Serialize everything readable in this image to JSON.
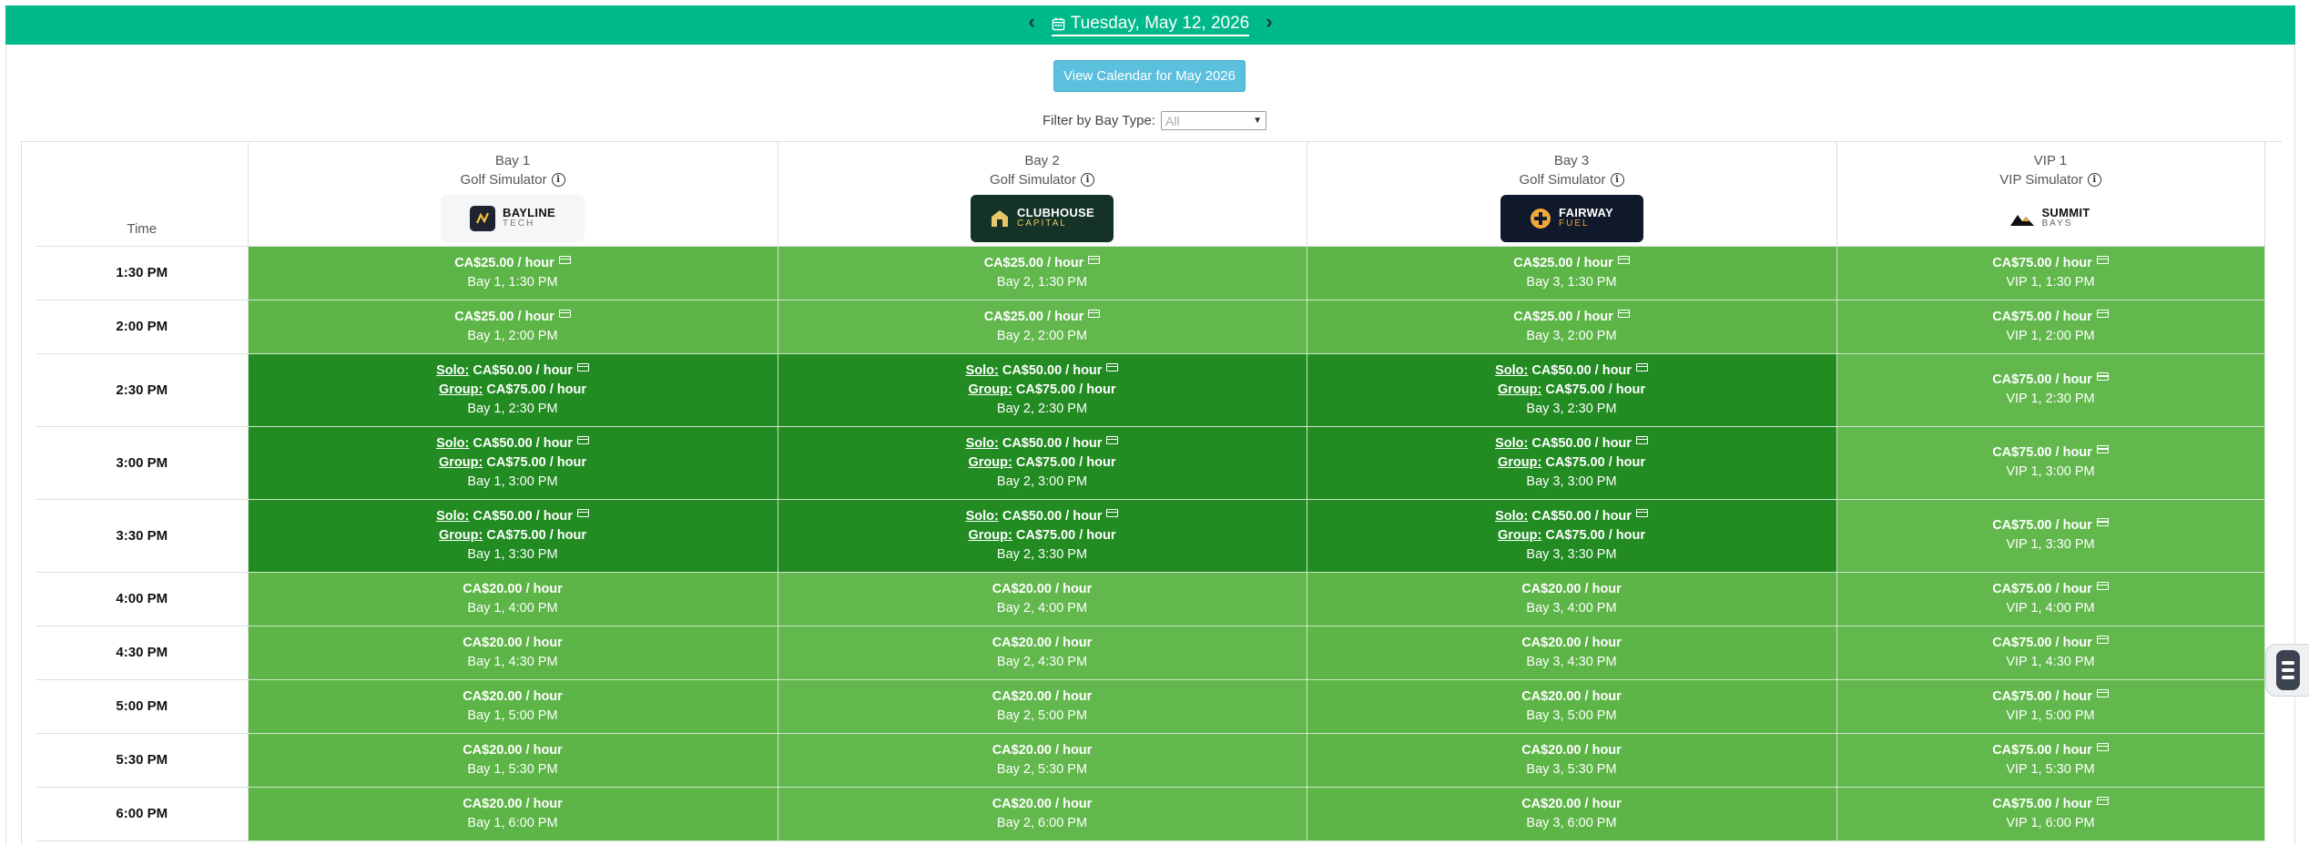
{
  "header": {
    "date": "Tuesday, May 12, 2026",
    "prev_label": "‹",
    "next_label": "›"
  },
  "calendar_button": "View Calendar for May 2026",
  "filter": {
    "label": "Filter by Bay Type:",
    "selected": "All"
  },
  "time_header": "Time",
  "bays": [
    {
      "name": "Bay 1",
      "type": "Golf Simulator",
      "logo_line1": "BAYLINE",
      "logo_line2": "TECH"
    },
    {
      "name": "Bay 2",
      "type": "Golf Simulator",
      "logo_line1": "CLUBHOUSE",
      "logo_line2": "CAPITAL"
    },
    {
      "name": "Bay 3",
      "type": "Golf Simulator",
      "logo_line1": "FAIRWAY",
      "logo_line2": "FUEL"
    },
    {
      "name": "VIP 1",
      "type": "VIP Simulator",
      "logo_line1": "SUMMIT",
      "logo_line2": "BAYS"
    }
  ],
  "labels": {
    "solo": "Solo:",
    "group": "Group:"
  },
  "rows": [
    {
      "time": "1:30 PM",
      "cells": [
        {
          "kind": "light",
          "price": "CA$25.00 / hour",
          "card": true,
          "slot": "Bay 1, 1:30 PM"
        },
        {
          "kind": "light",
          "price": "CA$25.00 / hour",
          "card": true,
          "slot": "Bay 2, 1:30 PM"
        },
        {
          "kind": "light",
          "price": "CA$25.00 / hour",
          "card": true,
          "slot": "Bay 3, 1:30 PM"
        },
        {
          "kind": "light",
          "price": "CA$75.00 / hour",
          "card": true,
          "slot": "VIP 1, 1:30 PM"
        }
      ]
    },
    {
      "time": "2:00 PM",
      "cells": [
        {
          "kind": "light",
          "price": "CA$25.00 / hour",
          "card": true,
          "slot": "Bay 1, 2:00 PM"
        },
        {
          "kind": "light",
          "price": "CA$25.00 / hour",
          "card": true,
          "slot": "Bay 2, 2:00 PM"
        },
        {
          "kind": "light",
          "price": "CA$25.00 / hour",
          "card": true,
          "slot": "Bay 3, 2:00 PM"
        },
        {
          "kind": "light",
          "price": "CA$75.00 / hour",
          "card": true,
          "slot": "VIP 1, 2:00 PM"
        }
      ]
    },
    {
      "time": "2:30 PM",
      "cells": [
        {
          "kind": "dark",
          "solo": "CA$50.00 / hour",
          "group": "CA$75.00 / hour",
          "card": true,
          "slot": "Bay 1, 2:30 PM"
        },
        {
          "kind": "dark",
          "solo": "CA$50.00 / hour",
          "group": "CA$75.00 / hour",
          "card": true,
          "slot": "Bay 2, 2:30 PM"
        },
        {
          "kind": "dark",
          "solo": "CA$50.00 / hour",
          "group": "CA$75.00 / hour",
          "card": true,
          "slot": "Bay 3, 2:30 PM"
        },
        {
          "kind": "light",
          "price": "CA$75.00 / hour",
          "card": true,
          "slot": "VIP 1, 2:30 PM"
        }
      ]
    },
    {
      "time": "3:00 PM",
      "cells": [
        {
          "kind": "dark",
          "solo": "CA$50.00 / hour",
          "group": "CA$75.00 / hour",
          "card": true,
          "slot": "Bay 1, 3:00 PM"
        },
        {
          "kind": "dark",
          "solo": "CA$50.00 / hour",
          "group": "CA$75.00 / hour",
          "card": true,
          "slot": "Bay 2, 3:00 PM"
        },
        {
          "kind": "dark",
          "solo": "CA$50.00 / hour",
          "group": "CA$75.00 / hour",
          "card": true,
          "slot": "Bay 3, 3:00 PM"
        },
        {
          "kind": "light",
          "price": "CA$75.00 / hour",
          "card": true,
          "slot": "VIP 1, 3:00 PM"
        }
      ]
    },
    {
      "time": "3:30 PM",
      "cells": [
        {
          "kind": "dark",
          "solo": "CA$50.00 / hour",
          "group": "CA$75.00 / hour",
          "card": true,
          "slot": "Bay 1, 3:30 PM"
        },
        {
          "kind": "dark",
          "solo": "CA$50.00 / hour",
          "group": "CA$75.00 / hour",
          "card": true,
          "slot": "Bay 2, 3:30 PM"
        },
        {
          "kind": "dark",
          "solo": "CA$50.00 / hour",
          "group": "CA$75.00 / hour",
          "card": true,
          "slot": "Bay 3, 3:30 PM"
        },
        {
          "kind": "light",
          "price": "CA$75.00 / hour",
          "card": true,
          "slot": "VIP 1, 3:30 PM"
        }
      ]
    },
    {
      "time": "4:00 PM",
      "cells": [
        {
          "kind": "light",
          "price": "CA$20.00 / hour",
          "card": false,
          "slot": "Bay 1, 4:00 PM"
        },
        {
          "kind": "light",
          "price": "CA$20.00 / hour",
          "card": false,
          "slot": "Bay 2, 4:00 PM"
        },
        {
          "kind": "light",
          "price": "CA$20.00 / hour",
          "card": false,
          "slot": "Bay 3, 4:00 PM"
        },
        {
          "kind": "light",
          "price": "CA$75.00 / hour",
          "card": true,
          "slot": "VIP 1, 4:00 PM"
        }
      ]
    },
    {
      "time": "4:30 PM",
      "cells": [
        {
          "kind": "light",
          "price": "CA$20.00 / hour",
          "card": false,
          "slot": "Bay 1, 4:30 PM"
        },
        {
          "kind": "light",
          "price": "CA$20.00 / hour",
          "card": false,
          "slot": "Bay 2, 4:30 PM"
        },
        {
          "kind": "light",
          "price": "CA$20.00 / hour",
          "card": false,
          "slot": "Bay 3, 4:30 PM"
        },
        {
          "kind": "light",
          "price": "CA$75.00 / hour",
          "card": true,
          "slot": "VIP 1, 4:30 PM"
        }
      ]
    },
    {
      "time": "5:00 PM",
      "cells": [
        {
          "kind": "light",
          "price": "CA$20.00 / hour",
          "card": false,
          "slot": "Bay 1, 5:00 PM"
        },
        {
          "kind": "light",
          "price": "CA$20.00 / hour",
          "card": false,
          "slot": "Bay 2, 5:00 PM"
        },
        {
          "kind": "light",
          "price": "CA$20.00 / hour",
          "card": false,
          "slot": "Bay 3, 5:00 PM"
        },
        {
          "kind": "light",
          "price": "CA$75.00 / hour",
          "card": true,
          "slot": "VIP 1, 5:00 PM"
        }
      ]
    },
    {
      "time": "5:30 PM",
      "cells": [
        {
          "kind": "light",
          "price": "CA$20.00 / hour",
          "card": false,
          "slot": "Bay 1, 5:30 PM"
        },
        {
          "kind": "light",
          "price": "CA$20.00 / hour",
          "card": false,
          "slot": "Bay 2, 5:30 PM"
        },
        {
          "kind": "light",
          "price": "CA$20.00 / hour",
          "card": false,
          "slot": "Bay 3, 5:30 PM"
        },
        {
          "kind": "light",
          "price": "CA$75.00 / hour",
          "card": true,
          "slot": "VIP 1, 5:30 PM"
        }
      ]
    },
    {
      "time": "6:00 PM",
      "cells": [
        {
          "kind": "light",
          "price": "CA$20.00 / hour",
          "card": false,
          "slot": "Bay 1, 6:00 PM"
        },
        {
          "kind": "light",
          "price": "CA$20.00 / hour",
          "card": false,
          "slot": "Bay 2, 6:00 PM"
        },
        {
          "kind": "light",
          "price": "CA$20.00 / hour",
          "card": false,
          "slot": "Bay 3, 6:00 PM"
        },
        {
          "kind": "light",
          "price": "CA$75.00 / hour",
          "card": true,
          "slot": "VIP 1, 6:00 PM"
        }
      ]
    }
  ],
  "colors": {
    "header_green": "#00b98a",
    "slot_light": "#5db547",
    "slot_dark": "#228b22",
    "button_blue": "#5bc0de"
  },
  "icons": [
    "chevron-left-icon",
    "calendar-icon",
    "chevron-right-icon",
    "info-icon",
    "credit-card-icon",
    "accessibility-widget-icon"
  ]
}
